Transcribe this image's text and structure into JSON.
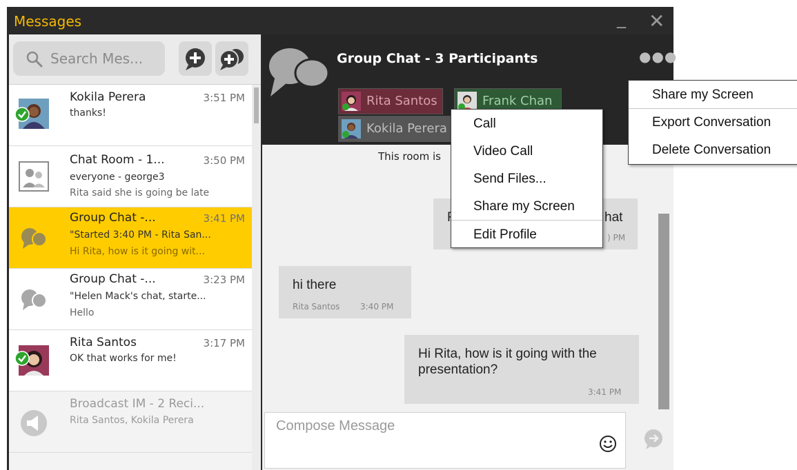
{
  "window": {
    "title": "Messages"
  },
  "search": {
    "placeholder": "Search Mes..."
  },
  "conversations": [
    {
      "name": "Kokila Perera",
      "time": "3:51 PM",
      "line2": "thanks!",
      "line3": ""
    },
    {
      "name": "Chat Room - 1...",
      "time": "3:50 PM",
      "line2": "everyone - george3",
      "line3": "Rita said she is going be late"
    },
    {
      "name": "Group Chat -...",
      "time": "3:41 PM",
      "line2": "\"Started 3:40 PM - Rita San...",
      "line3": "Hi Rita, how is it going wit..."
    },
    {
      "name": "Group Chat -...",
      "time": "3:23 PM",
      "line2": "\"Helen Mack's chat, starte...",
      "line3": "Hello"
    },
    {
      "name": "Rita Santos",
      "time": "3:17 PM",
      "line2": "OK that works for me!",
      "line3": ""
    },
    {
      "name": "Broadcast IM - 2 Reci...",
      "time": "",
      "line2": "Rita Santos, Kokila Perera",
      "line3": ""
    }
  ],
  "chat": {
    "title": "Group Chat - 3 Participants",
    "participants": [
      "Rita Santos",
      "Frank Chan",
      "Kokila Perera"
    ],
    "notice": "This room is",
    "messages": [
      {
        "text": "F",
        "text_end": "hat",
        "meta": ") PM"
      },
      {
        "text": "hi there",
        "sender": "Rita Santos",
        "time": "3:40 PM"
      },
      {
        "text": "Hi Rita, how is it going with the presentation?",
        "time": "3:41 PM"
      }
    ],
    "compose_placeholder": "Compose Message"
  },
  "context_menu": {
    "items": [
      "Call",
      "Video Call",
      "Send Files...",
      "Share my Screen",
      "Edit Profile"
    ]
  },
  "more_menu": {
    "items": [
      "Share my Screen",
      "Export Conversation",
      "Delete Conversation"
    ]
  },
  "icons": {
    "search": "search-icon",
    "add": "plus-circle-icon",
    "add_chat": "chat-plus-icon",
    "group": "chat-bubbles-icon",
    "room": "people-icon",
    "broadcast": "megaphone-icon",
    "status": "check-status-icon",
    "emoji": "smiley-icon",
    "send": "send-icon",
    "more": "ellipsis-icon",
    "minimize": "minimize-icon",
    "close": "close-icon"
  },
  "colors": {
    "accent": "#f5b800",
    "selected": "#ffcc00",
    "online": "#2ea52e",
    "header_bg": "#262626"
  }
}
